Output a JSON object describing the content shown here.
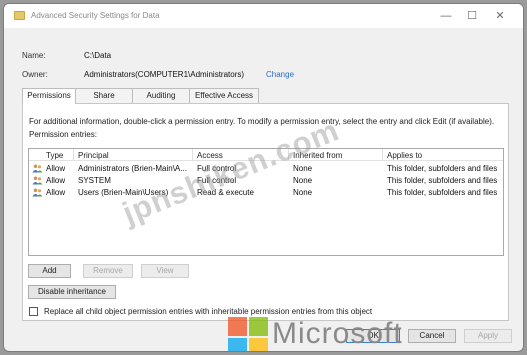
{
  "window": {
    "title": "Advanced Security Settings for Data",
    "minimize": "—",
    "maximize": "☐",
    "close": "✕"
  },
  "details": {
    "name_label": "Name:",
    "name_value": "C:\\Data",
    "owner_label": "Owner:",
    "owner_value": "Administrators(COMPUTER1\\Administrators)",
    "change_link": "Change"
  },
  "tabs": [
    {
      "label": "Permissions",
      "active": true
    },
    {
      "label": "Share",
      "active": false
    },
    {
      "label": "Auditing",
      "active": false
    },
    {
      "label": "Effective Access",
      "active": false
    }
  ],
  "permissions": {
    "info_text": "For additional information, double-click a permission entry. To modify a permission entry, select the entry and click Edit (if available).",
    "entries_label": "Permission entries:",
    "columns": [
      "Type",
      "Principal",
      "Access",
      "Inherited from",
      "Applies to"
    ],
    "rows": [
      {
        "type": "Allow",
        "principal": "Administrators (Brien-Main\\A...",
        "access": "Full control",
        "inherited": "None",
        "applies": "This folder, subfolders and files"
      },
      {
        "type": "Allow",
        "principal": "SYSTEM",
        "access": "Full control",
        "inherited": "None",
        "applies": "This folder, subfolders and files"
      },
      {
        "type": "Allow",
        "principal": "Users (Brien-Main\\Users)",
        "access": "Read & execute",
        "inherited": "None",
        "applies": "This folder, subfolders and files"
      }
    ],
    "add_button": "Add",
    "remove_button": "Remove",
    "view_button": "View",
    "disable_inheritance_button": "Disable inheritance",
    "replace_checkbox_label": "Replace all child object permission entries with inheritable permission entries from this object"
  },
  "footer": {
    "ok_button": "OK",
    "cancel_button": "Cancel",
    "apply_button": "Apply"
  },
  "overlay": {
    "watermark": "jpnshiken.com",
    "brand": "Microsoft",
    "brand_colors": [
      "#f25022",
      "#7fba00",
      "#00a4ef",
      "#ffb900"
    ]
  }
}
